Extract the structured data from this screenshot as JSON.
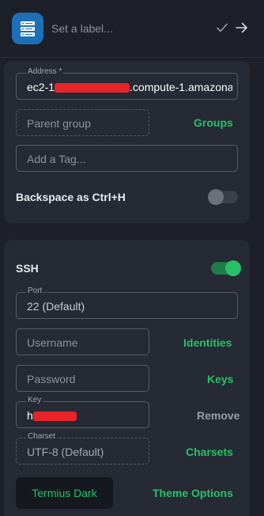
{
  "header": {
    "label_placeholder": "Set a label...",
    "confirm_icon": "checkmark-icon",
    "forward_icon": "arrow-right-icon",
    "app_icon": "server-icon",
    "app_icon_color": "#1d6fb8"
  },
  "general": {
    "address": {
      "legend": "Address *",
      "value_prefix": "ec2-1",
      "value_suffix": ".compute-1.amazona"
    },
    "parent_group": {
      "placeholder": "Parent group",
      "link": "Groups"
    },
    "tag": {
      "placeholder": "Add a Tag..."
    },
    "backspace": {
      "label": "Backspace as Ctrl+H",
      "enabled": false
    }
  },
  "ssh": {
    "title": "SSH",
    "enabled": true,
    "port": {
      "legend": "Port",
      "value": "22 (Default)"
    },
    "username": {
      "placeholder": "Username",
      "link": "Identities"
    },
    "password": {
      "placeholder": "Password",
      "link": "Keys"
    },
    "key": {
      "legend": "Key",
      "value_prefix": "h",
      "action": "Remove"
    },
    "charset": {
      "legend": "Charset",
      "value": "UTF-8 (Default)",
      "link": "Charsets"
    },
    "theme": {
      "button": "Termius Dark",
      "link": "Theme Options"
    }
  },
  "colors": {
    "accent": "#27c067",
    "background": "#1d2029",
    "card": "#262a34",
    "redaction": "#e8232a"
  }
}
